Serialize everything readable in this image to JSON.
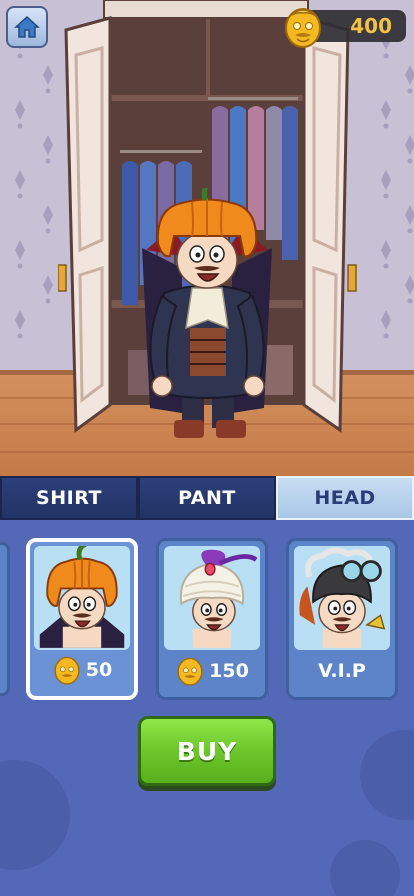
{
  "hud": {
    "home_icon": "home-icon",
    "coins": "400",
    "coin_icon": "gold-face-coin-icon"
  },
  "tabs": [
    {
      "label": "SHIRT",
      "active": false
    },
    {
      "label": "PANT",
      "active": false
    },
    {
      "label": "HEAD",
      "active": true
    }
  ],
  "items": [
    {
      "name": "pumpkin-head",
      "price": "50",
      "currency_icon": "gold-face-coin-icon",
      "selected": true
    },
    {
      "name": "turban-head",
      "price": "150",
      "currency_icon": "gold-face-coin-icon",
      "selected": false
    },
    {
      "name": "goggles-helmet-head",
      "price": "V.I.P",
      "currency_icon": "",
      "selected": false
    }
  ],
  "buy_button": {
    "label": "BUY"
  },
  "colors": {
    "accent_green": "#6cc62a",
    "tab_active": "#a9c7e6",
    "tab_inactive": "#223366",
    "shop_bg": "#5468b8",
    "coin_gold": "#f7c23a"
  }
}
